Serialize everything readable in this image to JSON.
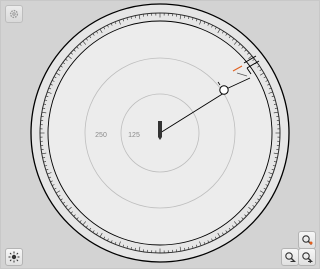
{
  "window": {
    "title": ""
  },
  "radar": {
    "range_rings": [
      {
        "label": "125"
      },
      {
        "label": "250"
      }
    ],
    "heading_marker_color": "#e06020",
    "own_ship_color": "#333333",
    "target_color": "#ffffff"
  },
  "controls": {
    "settings_icon": "gear-icon",
    "brightness_icon": "sun-icon",
    "zoom_range_icon": "zoom-range-icon",
    "zoom_out_icon": "zoom-out-icon",
    "zoom_in_icon": "zoom-in-icon",
    "accent_color": "#e06020"
  }
}
